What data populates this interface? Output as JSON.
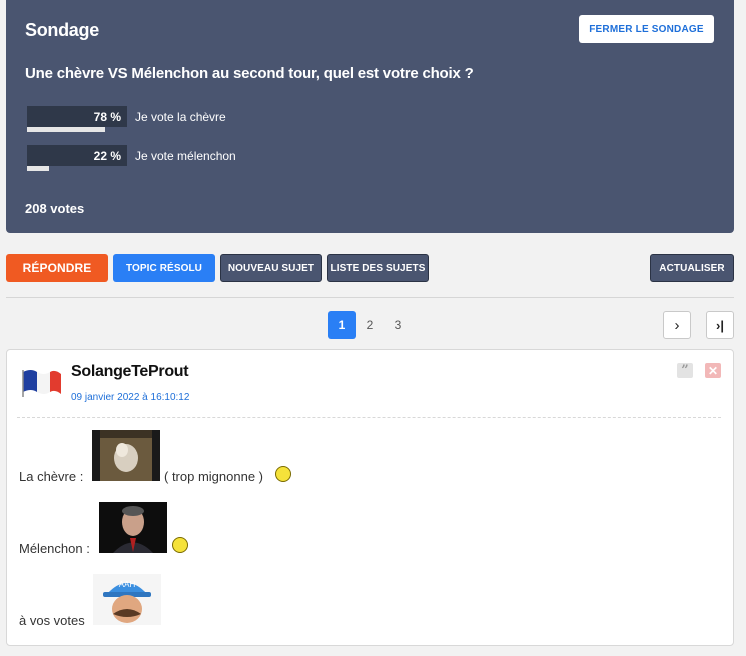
{
  "poll": {
    "title": "Sondage",
    "close_label": "FERMER LE SONDAGE",
    "question": "Une chèvre VS Mélenchon au second tour, quel est votre choix ?",
    "options": [
      {
        "percent_label": "78 %",
        "percent": 78,
        "label": "Je vote la chèvre"
      },
      {
        "percent_label": "22 %",
        "percent": 22,
        "label": "Je vote mélenchon"
      }
    ],
    "votes": "208 votes"
  },
  "toolbar": {
    "reply": "RÉPONDRE",
    "resolved": "TOPIC RÉSOLU",
    "new_topic": "NOUVEAU SUJET",
    "topic_list": "LISTE DES SUJETS",
    "refresh": "ACTUALISER"
  },
  "pagination": {
    "pages": [
      "1",
      "2",
      "3"
    ],
    "current": "1",
    "next_icon": "›",
    "last_icon": "›|"
  },
  "post": {
    "author": "SolangeTeProut",
    "date": "09 janvier 2022 à 16:10:12",
    "quote_icon": "quote-icon",
    "delete_icon": "close-icon",
    "line1_prefix": "La chèvre :",
    "line1_suffix": "( trop mignonne )",
    "line2_prefix": "Mélenchon :",
    "line3_prefix": "à vos votes",
    "hat_text": "AAH"
  },
  "colors": {
    "poll_bg": "#4a5570",
    "accent_blue": "#2a7ff5",
    "reply_orange": "#f05a22"
  }
}
